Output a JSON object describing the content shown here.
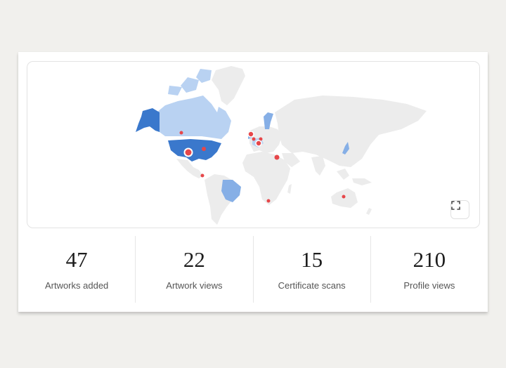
{
  "map": {
    "land_color": "#ececec",
    "highlight_dark": "#3a78cc",
    "highlight_medium": "#86afe6",
    "highlight_light": "#b9d2f2",
    "marker_color": "#e6474a",
    "fullscreen_label": "Fullscreen"
  },
  "stats": [
    {
      "value": "47",
      "label": "Artworks added"
    },
    {
      "value": "22",
      "label": "Artwork views"
    },
    {
      "value": "15",
      "label": "Certificate scans"
    },
    {
      "value": "210",
      "label": "Profile views"
    }
  ]
}
